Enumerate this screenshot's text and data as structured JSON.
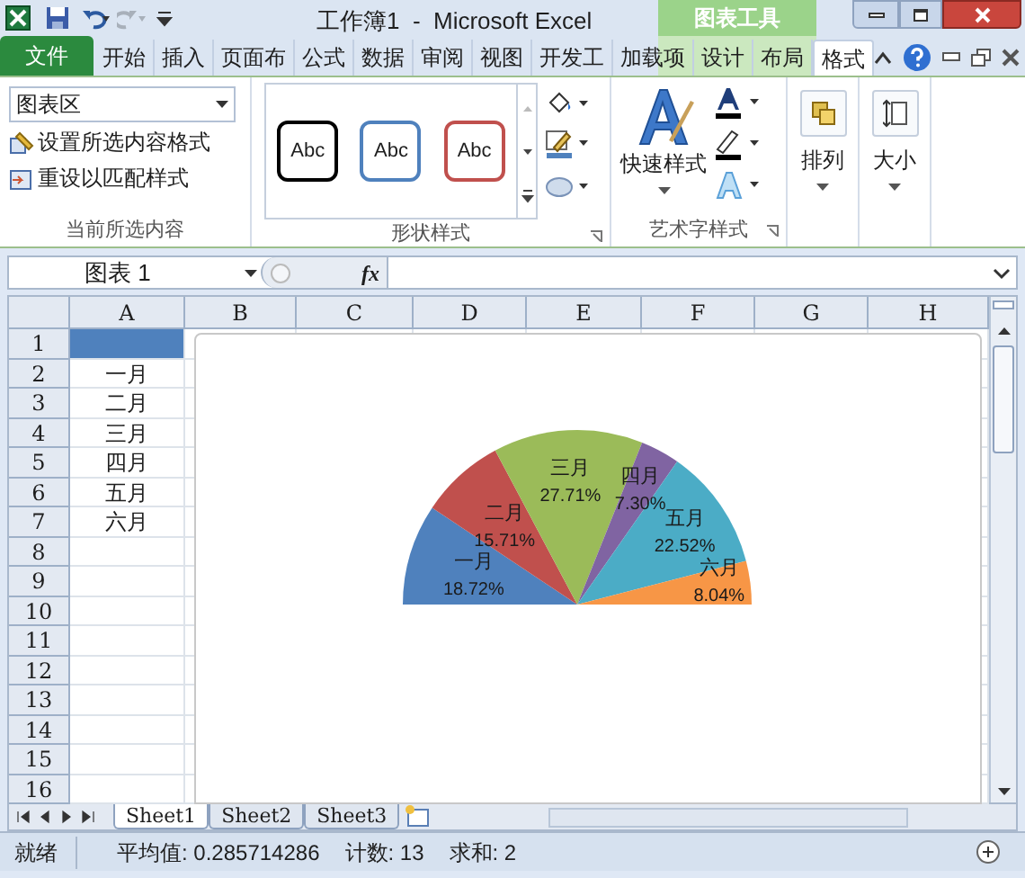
{
  "window": {
    "title": "工作簿1  -  Microsoft Excel",
    "context_group": "图表工具"
  },
  "ribbon_tabs": [
    {
      "label": "文件",
      "kind": "file",
      "selected": false
    },
    {
      "label": "开始",
      "kind": "tab",
      "selected": false
    },
    {
      "label": "插入",
      "kind": "tab",
      "selected": false
    },
    {
      "label": "页面布",
      "kind": "tab",
      "selected": false
    },
    {
      "label": "公式",
      "kind": "tab",
      "selected": false
    },
    {
      "label": "数据",
      "kind": "tab",
      "selected": false
    },
    {
      "label": "审阅",
      "kind": "tab",
      "selected": false
    },
    {
      "label": "视图",
      "kind": "tab",
      "selected": false
    },
    {
      "label": "开发工",
      "kind": "tab",
      "selected": false
    },
    {
      "label": "加载项",
      "kind": "tab",
      "selected": false
    },
    {
      "label": "设计",
      "kind": "context",
      "selected": false
    },
    {
      "label": "布局",
      "kind": "context",
      "selected": false
    },
    {
      "label": "格式",
      "kind": "context",
      "selected": true
    }
  ],
  "ribbon": {
    "current_selection": {
      "dropdown": "图表区",
      "commands": [
        "设置所选内容格式",
        "重设以匹配样式"
      ],
      "label": "当前所选内容"
    },
    "shape_styles": {
      "styles": [
        {
          "text": "Abc",
          "color": "#000000"
        },
        {
          "text": "Abc",
          "color": "#4f81bd"
        },
        {
          "text": "Abc",
          "color": "#c0504d"
        }
      ],
      "label": "形状样式"
    },
    "wordart_styles": {
      "quick_styles": "快速样式",
      "label": "艺术字样式"
    },
    "arrange": "排列",
    "size": "大小"
  },
  "formula_bar": {
    "name_box": "图表 1",
    "fx": "fx"
  },
  "sheet": {
    "columns": [
      "A",
      "B",
      "C",
      "D",
      "E",
      "F",
      "G",
      "H"
    ],
    "rows": [
      "1",
      "2",
      "3",
      "4",
      "5",
      "6",
      "7",
      "8",
      "9",
      "10",
      "11",
      "12",
      "13",
      "14",
      "15",
      "16"
    ],
    "column_a": [
      "一月",
      "二月",
      "三月",
      "四月",
      "五月",
      "六月"
    ]
  },
  "chart": {
    "chart_data": {
      "type": "pie",
      "categories": [
        "一月",
        "二月",
        "三月",
        "四月",
        "五月",
        "六月"
      ],
      "values": [
        18.72,
        15.71,
        27.71,
        7.3,
        22.52,
        8.04
      ],
      "value_labels": [
        "18.72%",
        "15.71%",
        "27.71%",
        "7.30%",
        "22.52%",
        "8.04%"
      ],
      "data_labels": true
    }
  },
  "sheet_tabs": [
    {
      "label": "Sheet1",
      "selected": true
    },
    {
      "label": "Sheet2",
      "selected": false
    },
    {
      "label": "Sheet3",
      "selected": false
    }
  ],
  "status_bar": {
    "mode": "就绪",
    "average": "平均值: 0.285714286",
    "count": "计数: 13",
    "sum": "求和: 2"
  }
}
